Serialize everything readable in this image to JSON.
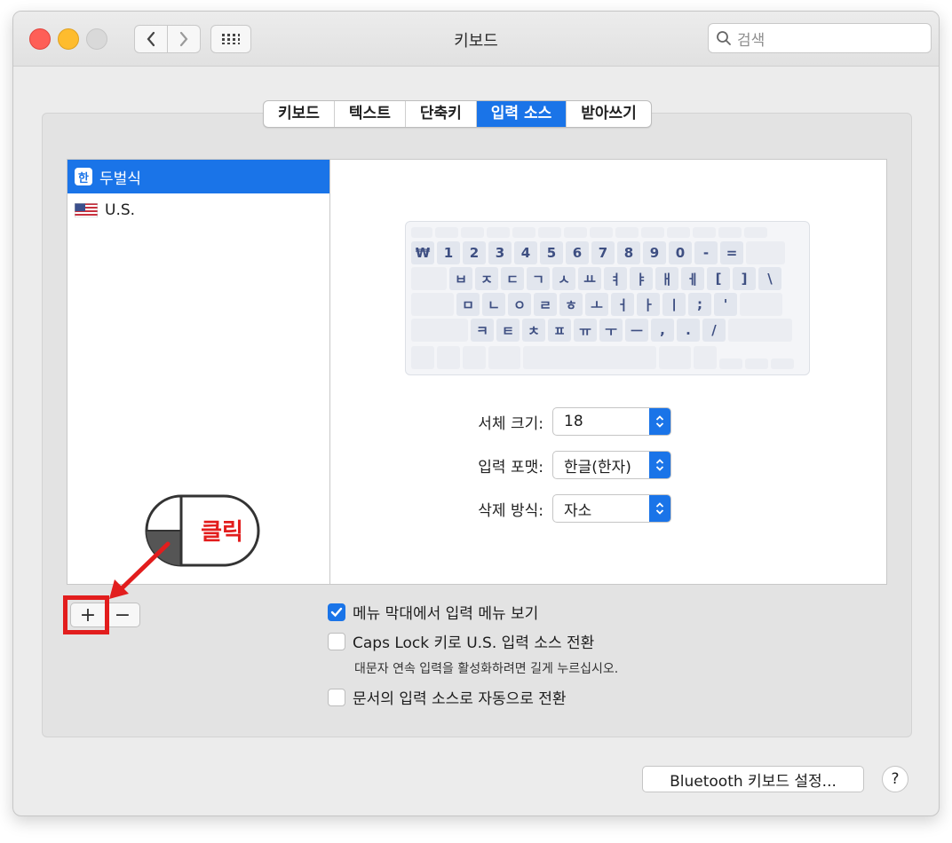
{
  "window": {
    "title": "키보드",
    "search_placeholder": "검색"
  },
  "tabs": [
    {
      "label": "키보드"
    },
    {
      "label": "텍스트"
    },
    {
      "label": "단축키"
    },
    {
      "label": "입력 소스",
      "active": true
    },
    {
      "label": "받아쓰기"
    }
  ],
  "input_sources": [
    {
      "icon": "han-icon",
      "icon_text": "한",
      "label": "두벌식",
      "selected": true
    },
    {
      "icon": "us-flag-icon",
      "label": "U.S."
    }
  ],
  "keyboard": {
    "row1": [
      "₩",
      "1",
      "2",
      "3",
      "4",
      "5",
      "6",
      "7",
      "8",
      "9",
      "0",
      "-",
      "="
    ],
    "row2": [
      "ㅂ",
      "ㅈ",
      "ㄷ",
      "ㄱ",
      "ㅅ",
      "ㅛ",
      "ㅕ",
      "ㅑ",
      "ㅐ",
      "ㅔ",
      "[",
      "]",
      "\\"
    ],
    "row3": [
      "ㅁ",
      "ㄴ",
      "ㅇ",
      "ㄹ",
      "ㅎ",
      "ㅗ",
      "ㅓ",
      "ㅏ",
      "ㅣ",
      ";",
      "'"
    ],
    "row4": [
      "ㅋ",
      "ㅌ",
      "ㅊ",
      "ㅍ",
      "ㅠ",
      "ㅜ",
      "ㅡ",
      ",",
      ".",
      "/"
    ]
  },
  "settings": {
    "font_size": {
      "label": "서체 크기:",
      "value": "18"
    },
    "input_format": {
      "label": "입력 포맷:",
      "value": "한글(한자)"
    },
    "delete_mode": {
      "label": "삭제 방식:",
      "value": "자소"
    }
  },
  "list_controls": {
    "plus": "+",
    "minus": "−"
  },
  "options": {
    "show_menu": {
      "label": "메뉴 막대에서 입력 메뉴 보기",
      "checked": true
    },
    "caps_lock": {
      "label": "Caps Lock 키로 U.S. 입력 소스 전환",
      "checked": false,
      "note": "대문자 연속 입력을 활성화하려면 길게 누르십시오."
    },
    "auto_switch": {
      "label": "문서의 입력 소스로 자동으로 전환",
      "checked": false
    }
  },
  "footer": {
    "bluetooth_button": "Bluetooth 키보드 설정...",
    "help": "?"
  },
  "annotation": {
    "click_label": "클릭",
    "color": "#e21d1d"
  },
  "colors": {
    "accent": "#1a74e8",
    "key_text": "#3e4f82"
  }
}
